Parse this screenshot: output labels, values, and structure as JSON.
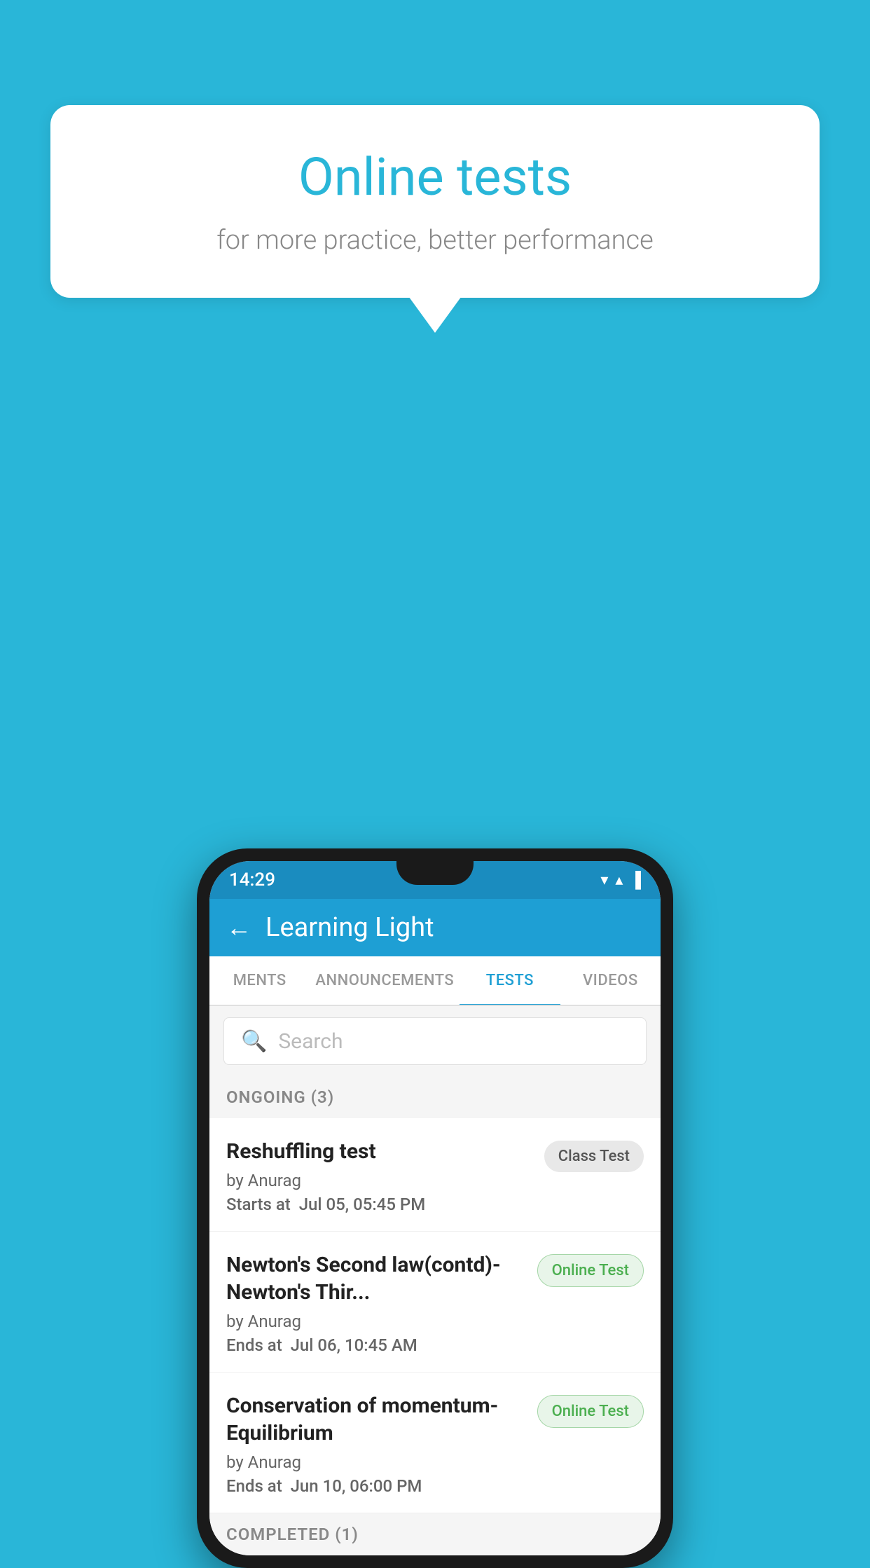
{
  "background": {
    "color": "#29b6d8"
  },
  "speech_bubble": {
    "title": "Online tests",
    "subtitle": "for more practice, better performance"
  },
  "phone": {
    "status_bar": {
      "time": "14:29",
      "wifi": "▼",
      "signal": "▲",
      "battery": "▐"
    },
    "header": {
      "back_label": "←",
      "title": "Learning Light"
    },
    "tabs": [
      {
        "label": "MENTS",
        "active": false
      },
      {
        "label": "ANNOUNCEMENTS",
        "active": false
      },
      {
        "label": "TESTS",
        "active": true
      },
      {
        "label": "VIDEOS",
        "active": false
      }
    ],
    "search": {
      "placeholder": "Search"
    },
    "sections": [
      {
        "label": "ONGOING (3)",
        "tests": [
          {
            "name": "Reshuffling test",
            "author": "by Anurag",
            "time_label": "Starts at",
            "time_value": "Jul 05, 05:45 PM",
            "badge": "Class Test",
            "badge_type": "class"
          },
          {
            "name": "Newton's Second law(contd)-Newton's Thir...",
            "author": "by Anurag",
            "time_label": "Ends at",
            "time_value": "Jul 06, 10:45 AM",
            "badge": "Online Test",
            "badge_type": "online"
          },
          {
            "name": "Conservation of momentum-Equilibrium",
            "author": "by Anurag",
            "time_label": "Ends at",
            "time_value": "Jun 10, 06:00 PM",
            "badge": "Online Test",
            "badge_type": "online"
          }
        ]
      }
    ],
    "completed_section_label": "COMPLETED (1)"
  }
}
